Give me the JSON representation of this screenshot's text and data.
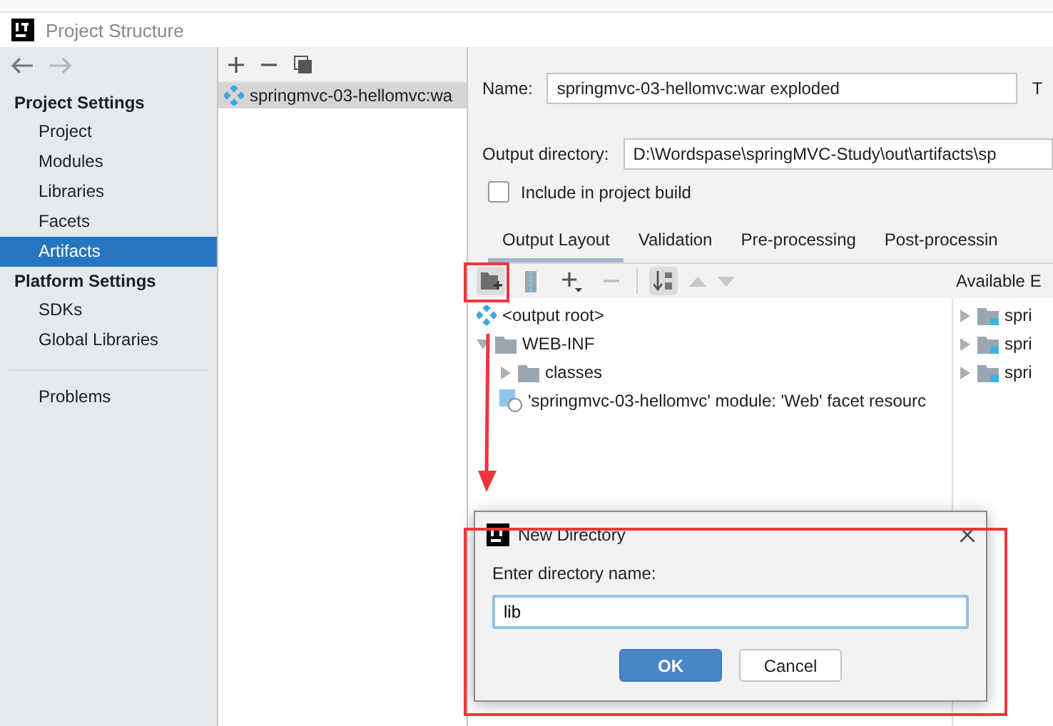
{
  "window": {
    "title": "Project Structure"
  },
  "sidebar": {
    "sections": [
      {
        "heading": "Project Settings",
        "items": [
          {
            "label": "Project",
            "selected": false
          },
          {
            "label": "Modules",
            "selected": false
          },
          {
            "label": "Libraries",
            "selected": false
          },
          {
            "label": "Facets",
            "selected": false
          },
          {
            "label": "Artifacts",
            "selected": true
          }
        ]
      },
      {
        "heading": "Platform Settings",
        "items": [
          {
            "label": "SDKs",
            "selected": false
          },
          {
            "label": "Global Libraries",
            "selected": false
          }
        ]
      }
    ],
    "footer_items": [
      {
        "label": "Problems",
        "selected": false
      }
    ]
  },
  "artifacts": [
    {
      "name": "springmvc-03-hellomvc:wa",
      "selected": true
    }
  ],
  "form": {
    "name_label": "Name:",
    "name_value": "springmvc-03-hellomvc:war exploded",
    "type_label": "T",
    "output_label": "Output directory:",
    "output_value": "D:\\Wordspase\\springMVC-Study\\out\\artifacts\\sp",
    "include": {
      "label": "Include in project build",
      "checked": false
    }
  },
  "tabs": [
    {
      "label": "Output Layout",
      "selected": true
    },
    {
      "label": "Validation",
      "selected": false
    },
    {
      "label": "Pre-processing",
      "selected": false
    },
    {
      "label": "Post-processin",
      "selected": false
    }
  ],
  "layout_tree": [
    {
      "kind": "root",
      "label": "<output root>"
    },
    {
      "kind": "folder",
      "label": "WEB-INF",
      "expanded": true,
      "children": [
        {
          "kind": "folder",
          "label": "classes",
          "expanded": false
        }
      ]
    },
    {
      "kind": "module",
      "label": "'springmvc-03-hellomvc' module: 'Web' facet resourc"
    }
  ],
  "available": {
    "label": "Available E",
    "items": [
      {
        "label": "spri",
        "expanded": false
      },
      {
        "label": "spri",
        "expanded": false
      },
      {
        "label": "spri",
        "expanded": false
      }
    ]
  },
  "dialog": {
    "title": "New Directory",
    "prompt": "Enter directory name:",
    "value": "lib",
    "buttons": [
      {
        "label": "OK",
        "kind": "primary"
      },
      {
        "label": "Cancel",
        "kind": "secondary"
      }
    ]
  }
}
